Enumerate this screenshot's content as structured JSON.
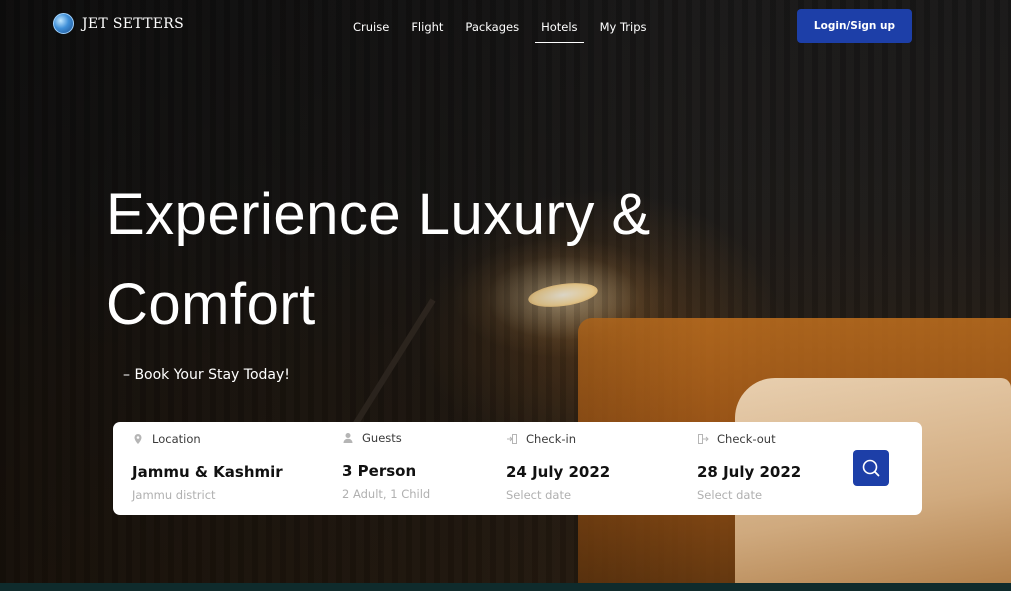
{
  "brand": {
    "name": "JET SETTERS",
    "logo_icon": "globe-icon"
  },
  "nav": {
    "items": [
      {
        "label": "Cruise"
      },
      {
        "label": "Flight"
      },
      {
        "label": "Packages"
      },
      {
        "label": "Hotels"
      },
      {
        "label": "My Trips"
      }
    ],
    "active": "Hotels",
    "login_label": "Login/Sign up"
  },
  "hero": {
    "title_line1": "Experience Luxury &",
    "title_line2": "Comfort",
    "subtitle": "– Book Your Stay Today!"
  },
  "booking": {
    "location": {
      "label": "Location",
      "icon": "location-pin-icon",
      "value": "Jammu & Kashmir",
      "hint": "Jammu district"
    },
    "guests": {
      "label": "Guests",
      "icon": "person-icon",
      "value": "3 Person",
      "hint": "2 Adult, 1 Child"
    },
    "checkin": {
      "label": "Check-in",
      "icon": "check-in-icon",
      "value": "24 July 2022",
      "hint": "Select date"
    },
    "checkout": {
      "label": "Check-out",
      "icon": "check-out-icon",
      "value": "28 July 2022",
      "hint": "Select date"
    },
    "search_icon": "search-icon"
  },
  "colors": {
    "accent": "#1d3fa8",
    "panel": "#ffffff",
    "text_dark": "#111111",
    "hint": "#b0b0b0"
  }
}
